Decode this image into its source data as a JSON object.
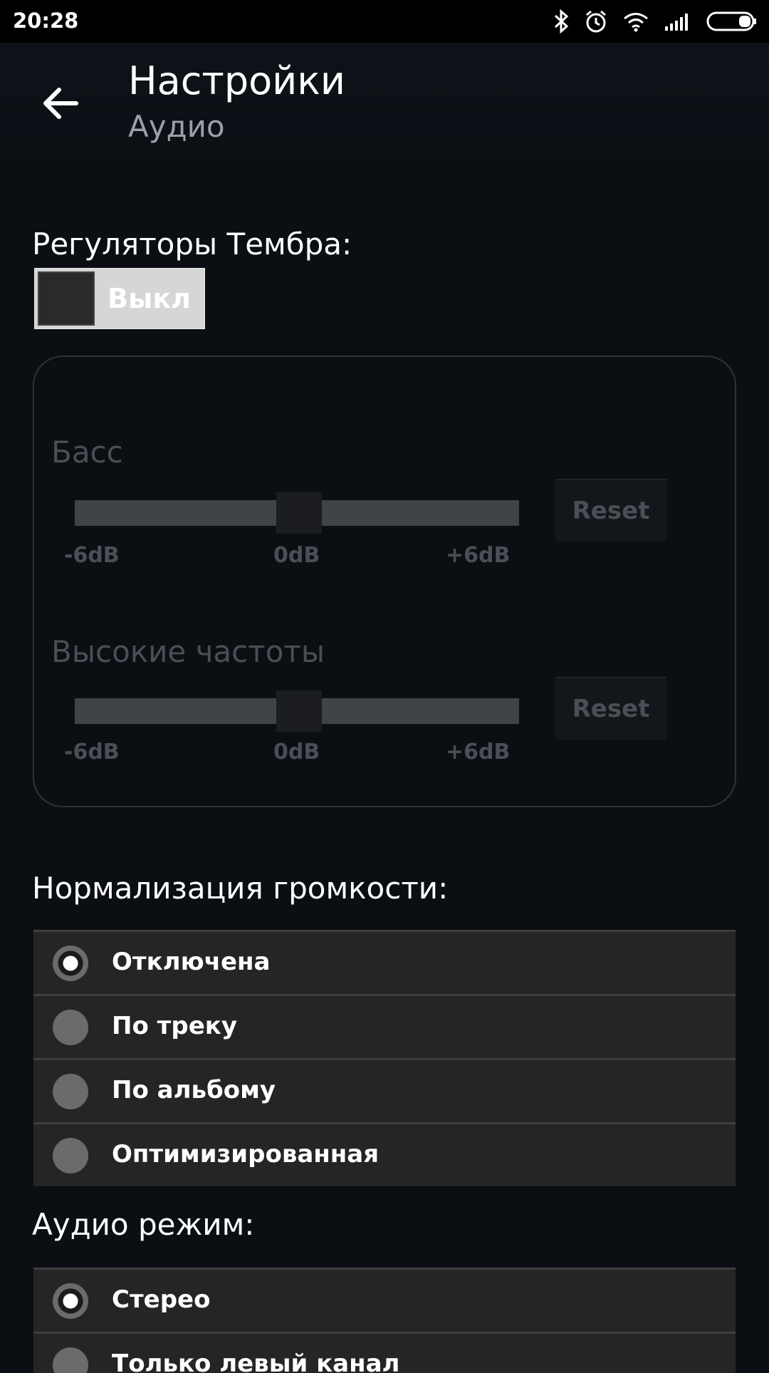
{
  "status_bar": {
    "time": "20:28",
    "icons": [
      "bluetooth-icon",
      "alarm-icon",
      "wifi-icon",
      "signal-icon",
      "battery-icon"
    ]
  },
  "header": {
    "title": "Настройки",
    "subtitle": "Аудио"
  },
  "tone": {
    "label": "Регуляторы Тембра:",
    "toggle_state": "Выкл",
    "bass": {
      "label": "Басс",
      "ticks": [
        "-6dB",
        "0dB",
        "+6dB"
      ],
      "reset_label": "Reset",
      "value_fraction": 0.5
    },
    "treble": {
      "label": "Высокие частоты",
      "ticks": [
        "-6dB",
        "0dB",
        "+6dB"
      ],
      "reset_label": "Reset",
      "value_fraction": 0.5
    }
  },
  "normalization": {
    "label": "Нормализация громкости:",
    "options": [
      {
        "label": "Отключена",
        "selected": true
      },
      {
        "label": "По треку",
        "selected": false
      },
      {
        "label": "По альбому",
        "selected": false
      },
      {
        "label": "Оптимизированная",
        "selected": false
      }
    ]
  },
  "audio_mode": {
    "label": "Аудио режим:",
    "options": [
      {
        "label": "Стерео",
        "selected": true
      },
      {
        "label": "Только левый канал",
        "selected": false
      }
    ]
  }
}
